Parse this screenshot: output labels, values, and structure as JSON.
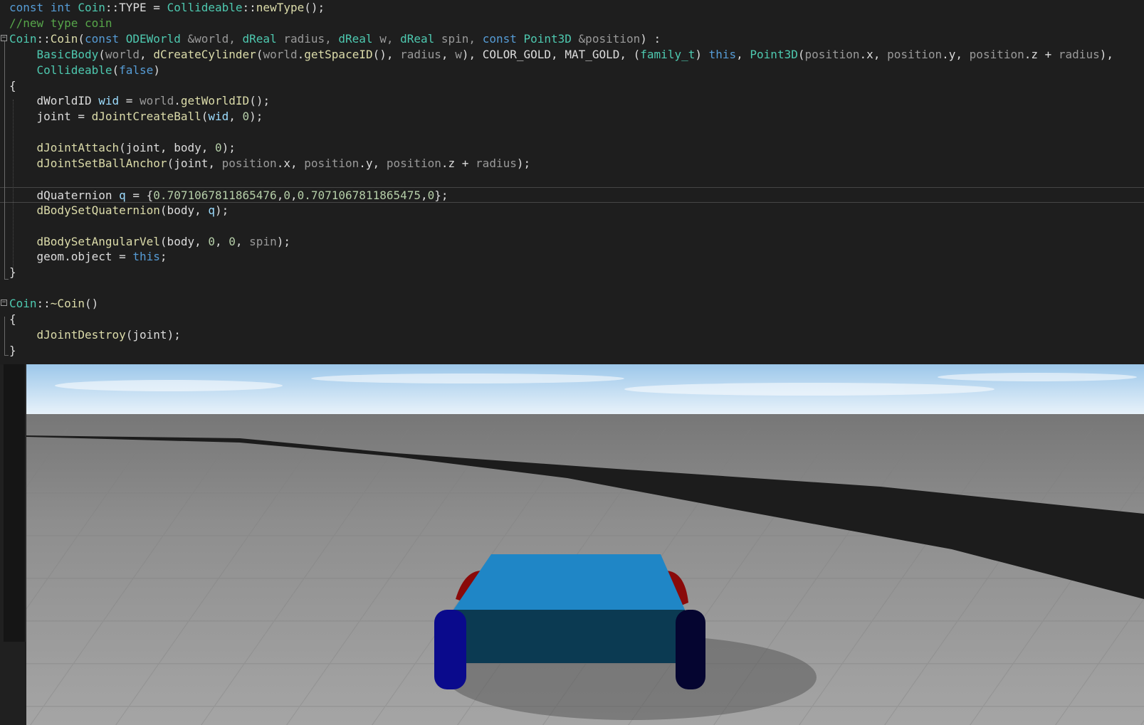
{
  "editor": {
    "lines": [
      {
        "tokens": [
          {
            "t": "const ",
            "c": "kw"
          },
          {
            "t": "int ",
            "c": "kw"
          },
          {
            "t": "Coin",
            "c": "ty"
          },
          {
            "t": "::TYPE = "
          },
          {
            "t": "Collideable",
            "c": "ty"
          },
          {
            "t": "::"
          },
          {
            "t": "newType",
            "c": "fn"
          },
          {
            "t": "();"
          }
        ]
      },
      {
        "tokens": [
          {
            "t": "//new type coin",
            "c": "cm"
          }
        ]
      },
      {
        "fold": "minus",
        "tokens": [
          {
            "t": "Coin",
            "c": "ty"
          },
          {
            "t": "::"
          },
          {
            "t": "Coin",
            "c": "fn"
          },
          {
            "t": "("
          },
          {
            "t": "const ",
            "c": "kw"
          },
          {
            "t": "ODEWorld ",
            "c": "ty"
          },
          {
            "t": "&world, ",
            "c": "pm"
          },
          {
            "t": "dReal ",
            "c": "ty"
          },
          {
            "t": "radius, ",
            "c": "pm"
          },
          {
            "t": "dReal ",
            "c": "ty"
          },
          {
            "t": "w, ",
            "c": "pm"
          },
          {
            "t": "dReal ",
            "c": "ty"
          },
          {
            "t": "spin, ",
            "c": "pm"
          },
          {
            "t": "const ",
            "c": "kw"
          },
          {
            "t": "Point3D ",
            "c": "ty"
          },
          {
            "t": "&position",
            "c": "pm"
          },
          {
            "t": ") :"
          }
        ]
      },
      {
        "tokens": [
          {
            "t": "    "
          },
          {
            "t": "BasicBody",
            "c": "ty"
          },
          {
            "t": "("
          },
          {
            "t": "world",
            "c": "pm"
          },
          {
            "t": ", "
          },
          {
            "t": "dCreateCylinder",
            "c": "fn"
          },
          {
            "t": "("
          },
          {
            "t": "world",
            "c": "pm"
          },
          {
            "t": "."
          },
          {
            "t": "getSpaceID",
            "c": "fn"
          },
          {
            "t": "(), "
          },
          {
            "t": "radius",
            "c": "pm"
          },
          {
            "t": ", "
          },
          {
            "t": "w",
            "c": "pm"
          },
          {
            "t": "), COLOR_GOLD, MAT_GOLD, ("
          },
          {
            "t": "family_t",
            "c": "ty"
          },
          {
            "t": ") "
          },
          {
            "t": "this",
            "c": "kw"
          },
          {
            "t": ", "
          },
          {
            "t": "Point3D",
            "c": "ty"
          },
          {
            "t": "("
          },
          {
            "t": "position",
            "c": "pm"
          },
          {
            "t": ".x, "
          },
          {
            "t": "position",
            "c": "pm"
          },
          {
            "t": ".y, "
          },
          {
            "t": "position",
            "c": "pm"
          },
          {
            "t": ".z + "
          },
          {
            "t": "radius",
            "c": "pm"
          },
          {
            "t": "),"
          }
        ]
      },
      {
        "tokens": [
          {
            "t": "    "
          },
          {
            "t": "Collideable",
            "c": "ty"
          },
          {
            "t": "("
          },
          {
            "t": "false",
            "c": "kw"
          },
          {
            "t": ")"
          }
        ]
      },
      {
        "tokens": [
          {
            "t": "{"
          }
        ]
      },
      {
        "tokens": [
          {
            "t": "    dWorldID "
          },
          {
            "t": "wid",
            "c": "vr"
          },
          {
            "t": " = "
          },
          {
            "t": "world",
            "c": "pm"
          },
          {
            "t": "."
          },
          {
            "t": "getWorldID",
            "c": "fn"
          },
          {
            "t": "();"
          }
        ]
      },
      {
        "tokens": [
          {
            "t": "    joint = "
          },
          {
            "t": "dJointCreateBall",
            "c": "fn"
          },
          {
            "t": "("
          },
          {
            "t": "wid",
            "c": "vr"
          },
          {
            "t": ", "
          },
          {
            "t": "0",
            "c": "nm"
          },
          {
            "t": ");"
          }
        ]
      },
      {
        "tokens": []
      },
      {
        "tokens": [
          {
            "t": "    "
          },
          {
            "t": "dJointAttach",
            "c": "fn"
          },
          {
            "t": "(joint, body, "
          },
          {
            "t": "0",
            "c": "nm"
          },
          {
            "t": ");"
          }
        ]
      },
      {
        "tokens": [
          {
            "t": "    "
          },
          {
            "t": "dJointSetBallAnchor",
            "c": "fn"
          },
          {
            "t": "(joint, "
          },
          {
            "t": "position",
            "c": "pm"
          },
          {
            "t": ".x, "
          },
          {
            "t": "position",
            "c": "pm"
          },
          {
            "t": ".y, "
          },
          {
            "t": "position",
            "c": "pm"
          },
          {
            "t": ".z + "
          },
          {
            "t": "radius",
            "c": "pm"
          },
          {
            "t": ");"
          }
        ]
      },
      {
        "tokens": []
      },
      {
        "current": true,
        "tokens": [
          {
            "t": "    dQuaternion "
          },
          {
            "t": "q",
            "c": "vr"
          },
          {
            "t": " = {"
          },
          {
            "t": "0.7071067811865476",
            "c": "nm"
          },
          {
            "t": ","
          },
          {
            "t": "0",
            "c": "nm"
          },
          {
            "t": ","
          },
          {
            "t": "0.7071067811865475",
            "c": "nm"
          },
          {
            "t": ","
          },
          {
            "t": "0",
            "c": "nm"
          },
          {
            "t": "};"
          }
        ]
      },
      {
        "tokens": [
          {
            "t": "    "
          },
          {
            "t": "dBodySetQuaternion",
            "c": "fn"
          },
          {
            "t": "(body, "
          },
          {
            "t": "q",
            "c": "vr"
          },
          {
            "t": ");"
          }
        ]
      },
      {
        "tokens": []
      },
      {
        "tokens": [
          {
            "t": "    "
          },
          {
            "t": "dBodySetAngularVel",
            "c": "fn"
          },
          {
            "t": "(body, "
          },
          {
            "t": "0",
            "c": "nm"
          },
          {
            "t": ", "
          },
          {
            "t": "0",
            "c": "nm"
          },
          {
            "t": ", "
          },
          {
            "t": "spin",
            "c": "pm"
          },
          {
            "t": ");"
          }
        ]
      },
      {
        "tokens": [
          {
            "t": "    geom.object = "
          },
          {
            "t": "this",
            "c": "kw"
          },
          {
            "t": ";"
          }
        ]
      },
      {
        "tokens": [
          {
            "t": "}"
          }
        ]
      },
      {
        "tokens": []
      },
      {
        "fold": "minus",
        "tokens": [
          {
            "t": "Coin",
            "c": "ty"
          },
          {
            "t": "::"
          },
          {
            "t": "~Coin",
            "c": "fn"
          },
          {
            "t": "()"
          }
        ]
      },
      {
        "tokens": [
          {
            "t": "{"
          }
        ]
      },
      {
        "tokens": [
          {
            "t": "    "
          },
          {
            "t": "dJointDestroy",
            "c": "fn"
          },
          {
            "t": "(joint);"
          }
        ]
      },
      {
        "tokens": [
          {
            "t": "}"
          }
        ]
      }
    ]
  },
  "simulation": {
    "sky_top": "#9cc7ea",
    "sky_bottom": "#e8f2fa",
    "ground_color": "#8e8e8e",
    "track_color": "#1c1c1c",
    "car_body_top": "#1f86c6",
    "car_body_back": "#0b3a52",
    "car_wheel_back": "#0a0a8c",
    "car_wheel_front": "#8a0a0a"
  }
}
